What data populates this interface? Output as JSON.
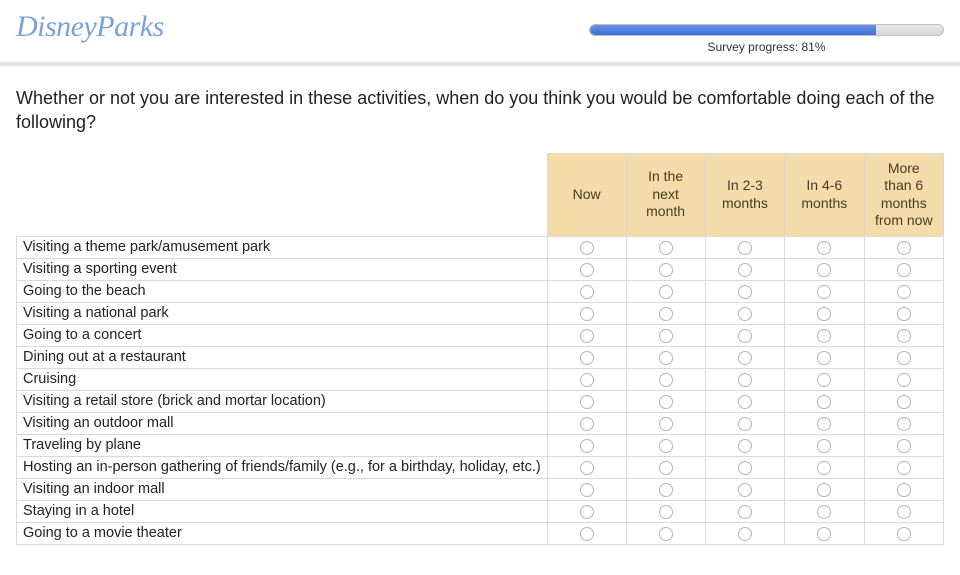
{
  "header": {
    "logo_text": "DisneyParks",
    "progress_percent": 81,
    "progress_label": "Survey progress: 81%"
  },
  "question": "Whether or not you are interested in these activities, when do you think you would be comfortable doing each of the following?",
  "columns": [
    "Now",
    "In the next month",
    "In 2-3 months",
    "In 4-6 months",
    "More than 6 months from now"
  ],
  "rows": [
    "Visiting a theme park/amusement park",
    "Visiting a sporting event",
    "Going to the beach",
    "Visiting a national park",
    "Going to a concert",
    "Dining out at a restaurant",
    "Cruising",
    "Visiting a retail store (brick and mortar location)",
    "Visiting an outdoor mall",
    "Traveling by plane",
    "Hosting an in-person gathering of friends/family (e.g., for a birthday, holiday, etc.)",
    "Visiting an indoor mall",
    "Staying in a hotel",
    "Going to a movie theater"
  ]
}
